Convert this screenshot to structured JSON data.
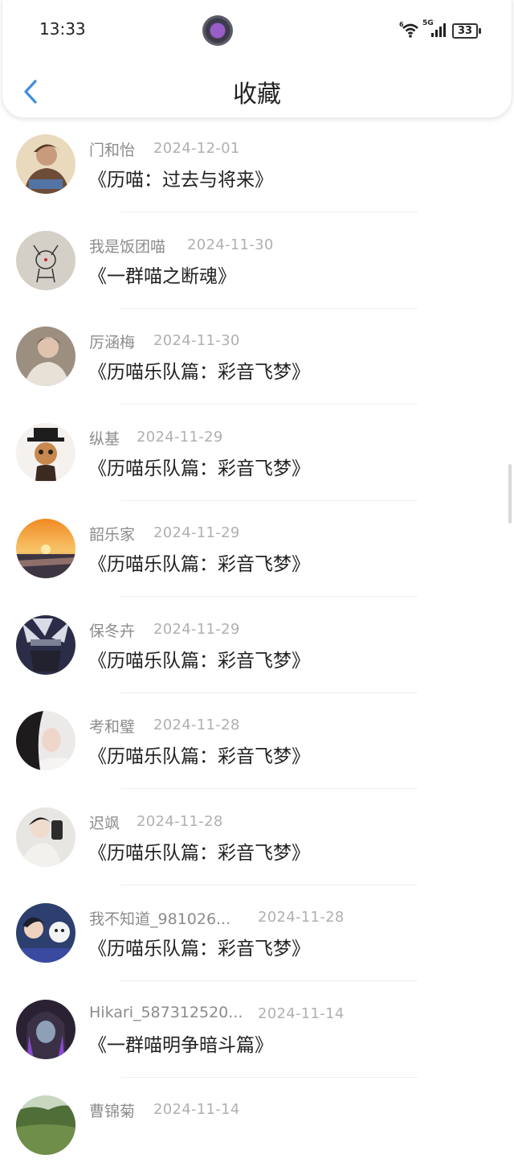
{
  "status": {
    "time": "13:33",
    "signal_label": "5G",
    "wifi_label": "6",
    "battery": "33"
  },
  "header": {
    "title": "收藏"
  },
  "items": [
    {
      "name": "门和怡",
      "date": "2024-12-01",
      "book": "《历喵：过去与将来》"
    },
    {
      "name": "我是饭团喵",
      "date": "2024-11-30",
      "book": "《一群喵之断魂》"
    },
    {
      "name": "厉涵梅",
      "date": "2024-11-30",
      "book": "《历喵乐队篇：彩音飞梦》"
    },
    {
      "name": "纵基",
      "date": "2024-11-29",
      "book": "《历喵乐队篇：彩音飞梦》"
    },
    {
      "name": "韶乐家",
      "date": "2024-11-29",
      "book": "《历喵乐队篇：彩音飞梦》"
    },
    {
      "name": "保冬卉",
      "date": "2024-11-29",
      "book": "《历喵乐队篇：彩音飞梦》"
    },
    {
      "name": "考和璧",
      "date": "2024-11-28",
      "book": "《历喵乐队篇：彩音飞梦》"
    },
    {
      "name": "迟飒",
      "date": "2024-11-28",
      "book": "《历喵乐队篇：彩音飞梦》"
    },
    {
      "name": "我不知道_981026...",
      "date": "2024-11-28",
      "book": "《历喵乐队篇：彩音飞梦》"
    },
    {
      "name": "Hikari_587312520...",
      "date": "2024-11-14",
      "book": "《一群喵明争暗斗篇》"
    },
    {
      "name": "曹锦菊",
      "date": "2024-11-14",
      "book": ""
    }
  ],
  "colors": {
    "back_arrow": "#3d8fe0",
    "name_text": "#8c8c8c",
    "date_text": "#b0b0b0"
  }
}
